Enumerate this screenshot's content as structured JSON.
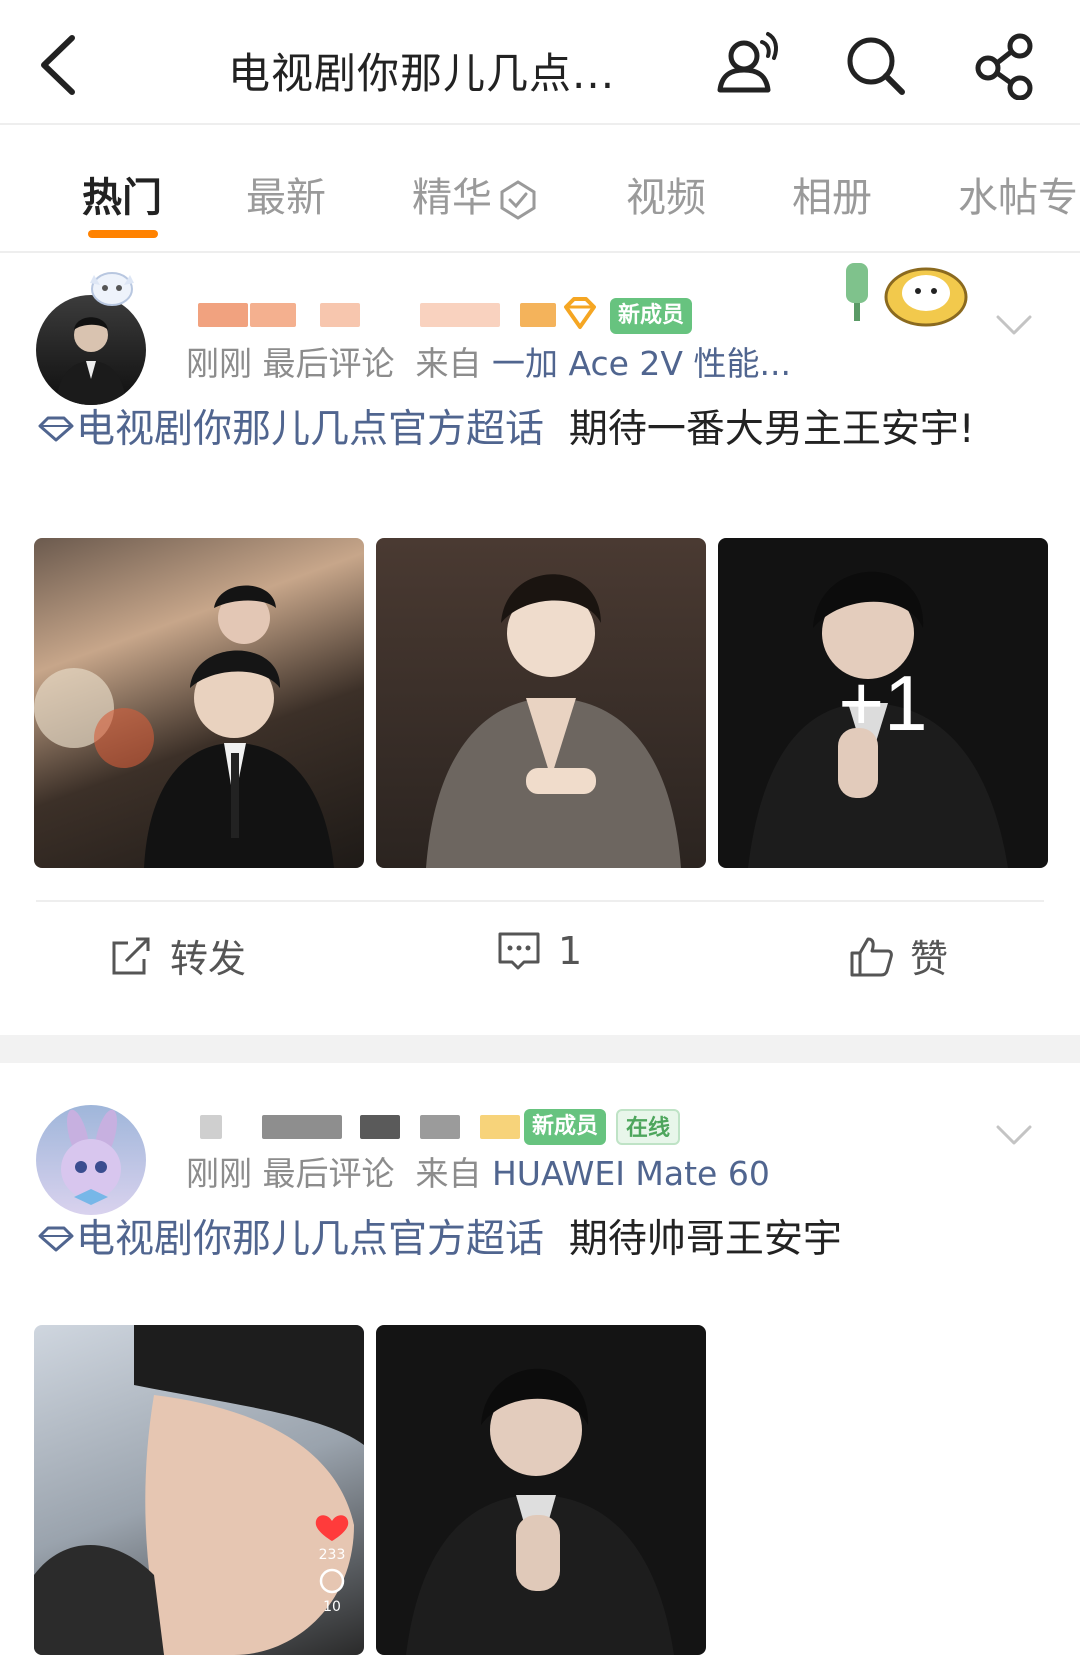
{
  "header": {
    "title": "电视剧你那儿几点...",
    "icons": [
      "back-arrow-icon",
      "members-icon",
      "search-icon",
      "share-icon"
    ]
  },
  "tabs": [
    {
      "label": "热门",
      "active": true
    },
    {
      "label": "最新",
      "active": false
    },
    {
      "label": "精华",
      "active": false
    },
    {
      "label": "视频",
      "active": false
    },
    {
      "label": "相册",
      "active": false
    },
    {
      "label": "水帖专",
      "active": false
    }
  ],
  "colors": {
    "accent": "#ff8200",
    "link": "#50658f",
    "member_tag": "#67c37f",
    "online_tag": "#4ea65d"
  },
  "posts": [
    {
      "member_tag": "新成员",
      "time": "刚刚",
      "last_comment": "最后评论",
      "from_label": "来自",
      "device": "一加 Ace 2V 性能...",
      "topic": "电视剧你那儿几点官方超话",
      "text": "期待一番大男主王安宇!",
      "extra_images": "+1",
      "actions": {
        "repost": "转发",
        "comments": "1",
        "like": "赞"
      }
    },
    {
      "member_tag": "新成员",
      "online_tag": "在线",
      "time": "刚刚",
      "last_comment": "最后评论",
      "from_label": "来自",
      "device": "HUAWEI Mate 60",
      "topic": "电视剧你那儿几点官方超话",
      "text": "期待帅哥王安宇",
      "overlay_likes": "233",
      "overlay_comments": "10"
    }
  ]
}
